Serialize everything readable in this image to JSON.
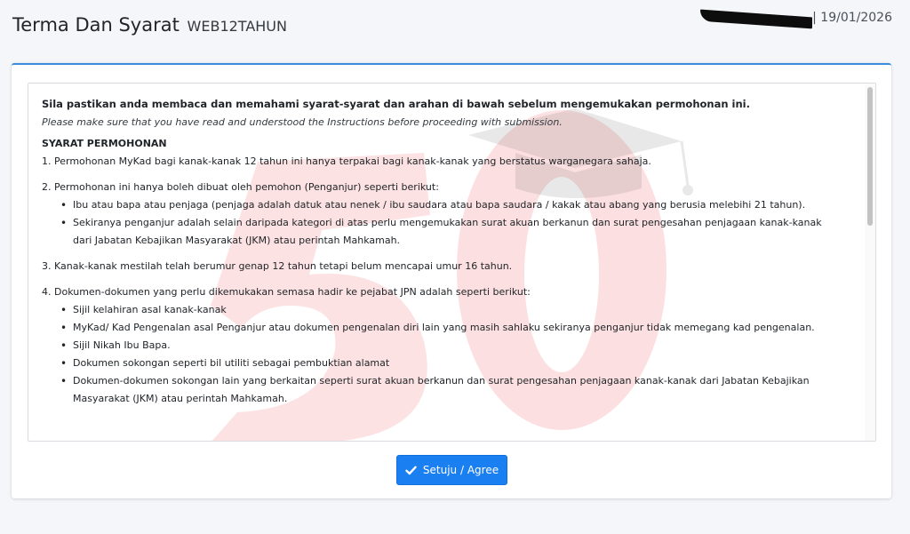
{
  "header": {
    "title": "Terma Dan Syarat",
    "app_code": "WEB12TAHUN",
    "date_text": "| 19/01/2026"
  },
  "terms": {
    "intro_ms": "Sila pastikan anda membaca dan memahami syarat-syarat dan arahan di bawah sebelum mengemukakan permohonan ini.",
    "intro_en": "Please make sure that you have read and understood the Instructions before proceeding with submission.",
    "section_heading": "SYARAT PERMOHONAN",
    "items": [
      {
        "text": "1. Permohonan MyKad bagi kanak-kanak 12 tahun ini hanya terpakai bagi kanak-kanak yang berstatus warganegara sahaja.",
        "sub": []
      },
      {
        "text": "2. Permohonan ini hanya boleh dibuat oleh pemohon (Penganjur) seperti berikut:",
        "sub": [
          "Ibu atau bapa atau penjaga (penjaga adalah datuk atau nenek / ibu saudara atau bapa saudara / kakak atau abang yang berusia melebihi 21 tahun).",
          "Sekiranya penganjur adalah selain daripada kategori di atas perlu mengemukakan surat akuan berkanun dan surat pengesahan penjagaan kanak-kanak dari Jabatan Kebajikan Masyarakat (JKM) atau perintah Mahkamah."
        ]
      },
      {
        "text": "3. Kanak-kanak mestilah telah berumur genap 12 tahun tetapi belum mencapai umur 16 tahun.",
        "sub": []
      },
      {
        "text": "4. Dokumen-dokumen yang perlu dikemukakan semasa hadir ke pejabat JPN adalah seperti berikut:",
        "sub": [
          "Sijil kelahiran asal kanak-kanak",
          "MyKad/ Kad Pengenalan asal Penganjur atau dokumen pengenalan diri lain yang masih sahlaku sekiranya penganjur tidak memegang kad pengenalan.",
          "Sijil Nikah Ibu Bapa.",
          "Dokumen sokongan seperti bil utiliti sebagai pembuktian alamat",
          "Dokumen-dokumen sokongan lain yang berkaitan seperti surat akuan berkanun dan surat pengesahan penjagaan kanak-kanak dari Jabatan Kebajikan Masyarakat (JKM) atau perintah Mahkamah."
        ]
      }
    ]
  },
  "actions": {
    "agree_label": "Setuju / Agree",
    "agree_icon": "check-icon"
  },
  "colors": {
    "primary": "#1a7ff0",
    "card_accent": "#3c8dde",
    "watermark": "#ef1c24"
  }
}
